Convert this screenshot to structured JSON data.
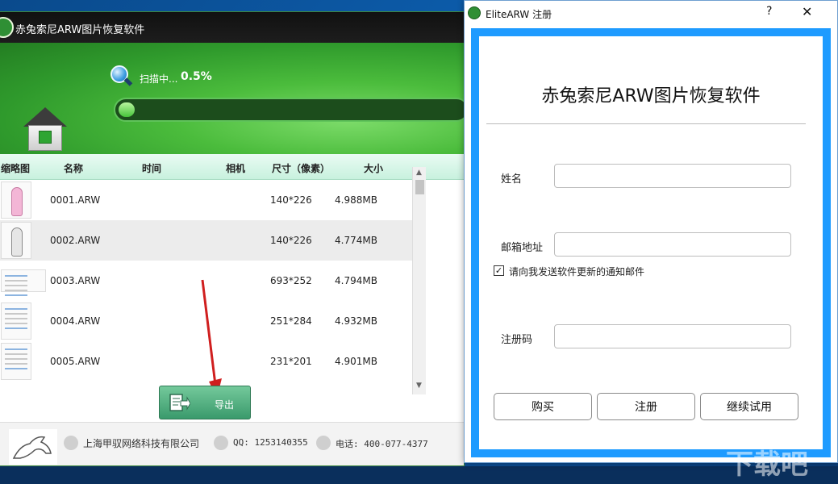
{
  "app": {
    "title": "赤兔索尼ARW图片恢复软件",
    "scan": {
      "status": "扫描中...",
      "percent_text": "0.5%",
      "progress": 0.005
    },
    "table": {
      "headers": [
        "缩略图",
        "名称",
        "时间",
        "相机",
        "尺寸（像素）",
        "大小"
      ],
      "rows": [
        {
          "name": "0001.ARW",
          "time": "",
          "camera": "",
          "size_px": "140*226",
          "file_size": "4.988MB",
          "thumb": "figure-pink"
        },
        {
          "name": "0002.ARW",
          "time": "",
          "camera": "",
          "size_px": "140*226",
          "file_size": "4.774MB",
          "thumb": "figure-white"
        },
        {
          "name": "0003.ARW",
          "time": "",
          "camera": "",
          "size_px": "693*252",
          "file_size": "4.794MB",
          "thumb": "screenshot-wide"
        },
        {
          "name": "0004.ARW",
          "time": "",
          "camera": "",
          "size_px": "251*284",
          "file_size": "4.932MB",
          "thumb": "screenshot"
        },
        {
          "name": "0005.ARW",
          "time": "",
          "camera": "",
          "size_px": "231*201",
          "file_size": "4.901MB",
          "thumb": "screenshot"
        }
      ]
    },
    "export_label": "导出",
    "footer": {
      "company": "上海甲驭网络科技有限公司",
      "qq": "QQ: 1253140355",
      "phone": "电话: 400-077-4377"
    }
  },
  "dialog": {
    "title": "EliteARW 注册",
    "help": "?",
    "close": "✕",
    "heading": "赤兔索尼ARW图片恢复软件",
    "name_label": "姓名",
    "name_value": "",
    "email_label": "邮箱地址",
    "email_value": "",
    "newsletter_checked": true,
    "newsletter_label": "请向我发送软件更新的通知邮件",
    "code_label": "注册码",
    "code_value": "",
    "buttons": {
      "buy": "购买",
      "register": "注册",
      "trial": "继续试用"
    }
  },
  "colors": {
    "accent_green": "#2f9a2c",
    "dialog_frame": "#1e9bff",
    "export_button": "#3a9a6c"
  }
}
